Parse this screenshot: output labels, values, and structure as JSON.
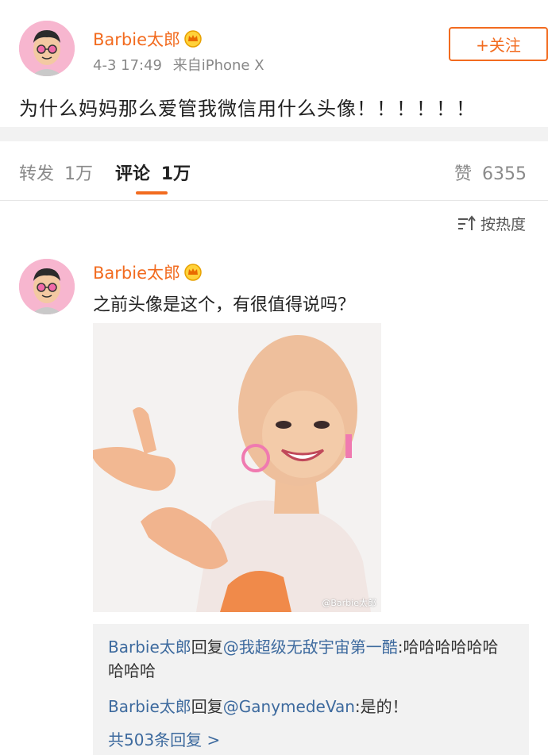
{
  "post": {
    "author": "Barbie太郎",
    "timestamp": "4-3 17:49",
    "source": "来自iPhone X",
    "follow_label": "+关注",
    "text": "为什么妈妈那么爱管我微信用什么头像！！！！！！"
  },
  "tabs": {
    "repost_label": "转发",
    "repost_count": "1万",
    "comment_label": "评论",
    "comment_count": "1万",
    "like_label": "赞",
    "like_count": "6355"
  },
  "sort": {
    "label": "按热度"
  },
  "comment": {
    "author": "Barbie太郎",
    "text": "之前头像是这个，有很值得说吗？",
    "image_watermark": "@Barbie太郎",
    "replies": [
      {
        "author": "Barbie太郎",
        "verb": "回复",
        "target": "@我超级无敌宇宙第一酷",
        "text": ":哈哈哈哈哈哈哈哈哈"
      },
      {
        "author": "Barbie太郎",
        "verb": "回复",
        "target": "@GanymedeVan",
        "text": ":是的！"
      }
    ],
    "more_replies": "共503条回复 >"
  },
  "colors": {
    "accent": "#f26b1f",
    "link": "#3d6a9e",
    "band": "#f2f2f2"
  }
}
